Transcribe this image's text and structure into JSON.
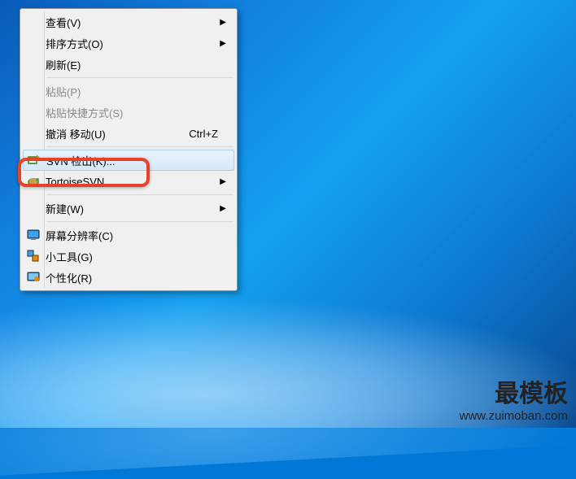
{
  "menu": {
    "view": "查看(V)",
    "sort": "排序方式(O)",
    "refresh": "刷新(E)",
    "paste": "粘贴(P)",
    "paste_shortcut": "粘贴快捷方式(S)",
    "undo_move": "撤消 移动(U)",
    "undo_move_shortcut": "Ctrl+Z",
    "svn_checkout": "SVN 检出(K)...",
    "tortoisesvn": "TortoiseSVN",
    "new": "新建(W)",
    "resolution": "屏幕分辨率(C)",
    "gadgets": "小工具(G)",
    "personalize": "个性化(R)"
  },
  "watermark": {
    "title": "最模板",
    "url": "www.zuimoban.com"
  }
}
